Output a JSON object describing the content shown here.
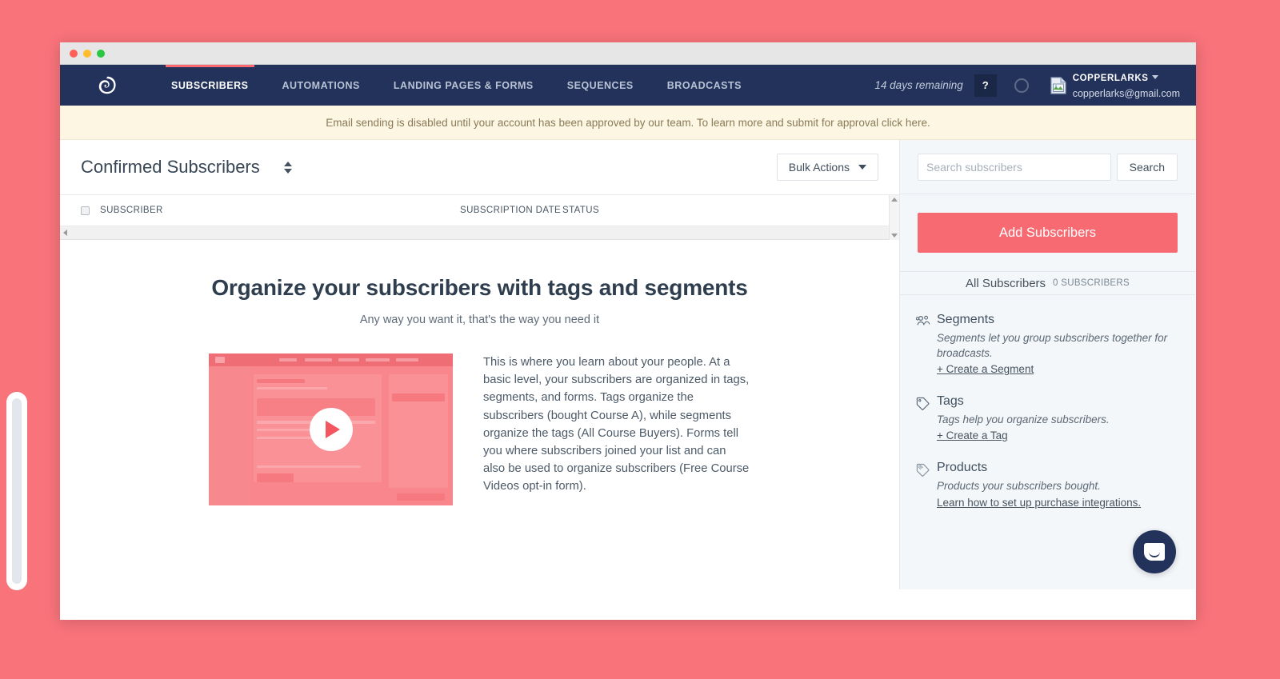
{
  "window": {
    "traffic_lights": [
      "close",
      "minimize",
      "zoom"
    ]
  },
  "nav": {
    "logo": "convertkit-logo-icon",
    "items": [
      {
        "label": "SUBSCRIBERS",
        "active": true
      },
      {
        "label": "AUTOMATIONS",
        "active": false
      },
      {
        "label": "LANDING PAGES & FORMS",
        "active": false
      },
      {
        "label": "SEQUENCES",
        "active": false
      },
      {
        "label": "BROADCASTS",
        "active": false
      }
    ],
    "trial_text": "14 days remaining",
    "help_label": "?",
    "status_icon": "circle-icon",
    "avatar_icon": "broken-image-icon",
    "account_name": "COPPERLARKS",
    "account_email": "copperlarks@gmail.com"
  },
  "alert": {
    "message": "Email sending is disabled until your account has been approved by our team. To learn more and submit for approval click here."
  },
  "page": {
    "title": "Confirmed Subscribers",
    "sort_icon": "sort-updown-icon",
    "bulk_actions_label": "Bulk Actions"
  },
  "table": {
    "columns": [
      "SUBSCRIBER",
      "SUBSCRIPTION DATE",
      "STATUS"
    ],
    "rows": []
  },
  "empty_state": {
    "title": "Organize your subscribers with tags and segments",
    "subtitle": "Any way you want it, that's the way you need it",
    "video_label": "play-button",
    "body": "This is where you learn about your people. At a basic level, your subscribers are organized in tags, segments, and forms. Tags organize the subscribers (bought Course A), while segments organize the tags (All Course Buyers). Forms tell you where subscribers joined your list and can also be used to organize subscribers (Free Course Videos opt-in form)."
  },
  "sidebar": {
    "search_placeholder": "Search subscribers",
    "search_value": "",
    "search_button": "Search",
    "add_subscribers_label": "Add Subscribers",
    "all_subscribers_label": "All Subscribers",
    "all_subscribers_count": "0 SUBSCRIBERS",
    "sections": [
      {
        "icon": "people-group-icon",
        "title": "Segments",
        "desc": "Segments let you group subscribers together for broadcasts.",
        "link": "+ Create a Segment"
      },
      {
        "icon": "tag-icon",
        "title": "Tags",
        "desc": "Tags help you organize subscribers.",
        "link": "+ Create a Tag"
      },
      {
        "icon": "product-tag-icon",
        "title": "Products",
        "desc": "Products your subscribers bought.",
        "link": "Learn how to set up purchase integrations."
      }
    ]
  },
  "colors": {
    "brand_pink": "#f76a72",
    "nav_dark": "#22325a",
    "alert_bg": "#fdf6e3",
    "page_bg": "#f9737b"
  },
  "widgets": {
    "intercom_label": "intercom-chat-icon"
  }
}
